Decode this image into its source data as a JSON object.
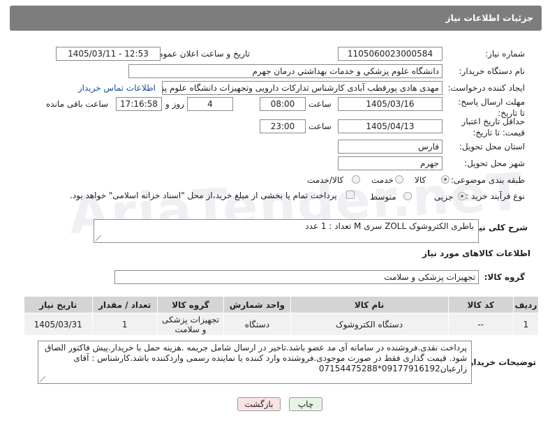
{
  "header": {
    "title": "جزئیات اطلاعات نیاز"
  },
  "labels": {
    "need_number": "شماره نیاز:",
    "announce_datetime": "تاریخ و ساعت اعلان عمومی:",
    "buyer_org": "نام دستگاه خریدار:",
    "requester": "ایجاد کننده درخواست:",
    "reply_deadline": "مهلت ارسال پاسخ: تا تاریخ:",
    "price_validity": "حداقل تاریخ اعتبار قیمت: تا تاریخ:",
    "hour": "ساعت",
    "day_and": "روز و",
    "time_left": "ساعت باقی مانده",
    "province": "استان محل تحویل:",
    "city": "شهر محل تحویل:",
    "category": "طبقه بندی موضوعی:",
    "purchase_type": "نوع فرآیند خرید :",
    "general_desc": "شرح کلی نیاز:",
    "goods_info": "اطلاعات کالاهای مورد نیاز",
    "goods_group": "گروه کالا:",
    "buyer_notes": "توضیحات خریدار:"
  },
  "fields": {
    "need_number": "1105060023000584",
    "announce_datetime": "1405/03/11 - 12:53",
    "buyer_org": "دانشگاه علوم پزشكي و خدمات بهداشتي  درمان جهرم",
    "requester": "مهدی هادی پورقطب آبادی کارشناس تدارکات دارویی وتجهیزات دانشگاه علوم پز",
    "contact_link": "اطلاعات تماس خریدار",
    "reply_date": "1405/03/16",
    "reply_time": "08:00",
    "days_left": "4",
    "hours_left": "17:16:58",
    "validity_date": "1405/04/13",
    "validity_time": "23:00",
    "province": "فارس",
    "city": "جهرم",
    "general_desc": "باطری الکتروشوک   ZOLL   سری M    تعداد : 1 عدد",
    "goods_group": "تجهیزات پزشکی و سلامت",
    "buyer_notes": "پرداخت نقدی.فروشنده در سامانه آی مد عضو باشد.تاخیر در ارسال شامل جریمه .هزینه حمل با خریدار.پیش فاکتور الصاق شود. قیمت گذاری فقط در صورت موجودی.فروشنده وارد کننده یا نماینده رسمی واردکننده باشد.کارشناس : آقای زارعیان09177916192*07154475288"
  },
  "category_options": [
    {
      "label": "کالا",
      "selected": true
    },
    {
      "label": "خدمت",
      "selected": false
    },
    {
      "label": "کالا/خدمت",
      "selected": false
    }
  ],
  "purchase_options": [
    {
      "label": "جزیی",
      "selected": true
    },
    {
      "label": "متوسط",
      "selected": false
    }
  ],
  "payment_note": "پرداخت تمام یا بخشی از مبلغ خرید،از محل \"اسناد خزانه اسلامی\" خواهد بود.",
  "table": {
    "headers": [
      "ردیف",
      "کد کالا",
      "نام کالا",
      "واحد شمارش",
      "گروه کالا",
      "تعداد / مقدار",
      "تاریخ نیاز"
    ],
    "rows": [
      [
        "1",
        "--",
        "دستگاه الکتروشوک",
        "دستگاه",
        "تجهیزات پزشکی و سلامت",
        "1",
        "1405/03/31"
      ]
    ]
  },
  "buttons": {
    "print": "چاپ",
    "back": "بازگشت"
  },
  "watermark": "AriaTender.neT",
  "colors": {
    "header_bg": "#7d7d7d",
    "link": "#1a4fa0",
    "print_bg": "#e6f5e3",
    "back_bg": "#fbe3e3"
  }
}
